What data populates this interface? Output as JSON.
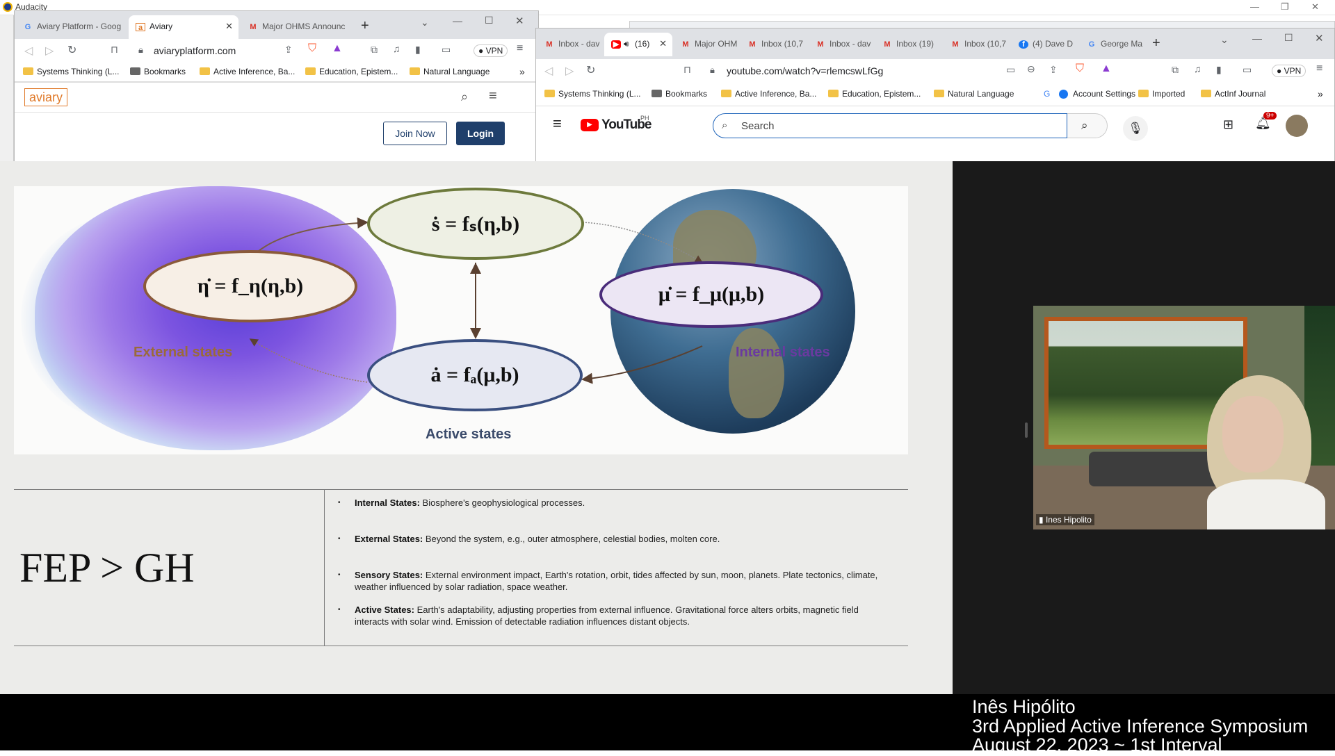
{
  "audacity": {
    "title": "Audacity"
  },
  "left_window": {
    "tabs": [
      {
        "label": "Aviary Platform - Goog"
      },
      {
        "label": "Aviary"
      },
      {
        "label": "Major OHMS Announc"
      }
    ],
    "url": "aviaryplatform.com",
    "vpn_label": "VPN",
    "bookmarks": [
      {
        "label": "Systems Thinking (L..."
      },
      {
        "label": "Bookmarks"
      },
      {
        "label": "Active Inference, Ba..."
      },
      {
        "label": "Education, Epistem..."
      },
      {
        "label": "Natural Language"
      }
    ],
    "page": {
      "logo": "aviary",
      "join_label": "Join Now",
      "login_label": "Login"
    }
  },
  "right_window": {
    "tabs": [
      {
        "label": "Inbox - dav"
      },
      {
        "label": "(16)"
      },
      {
        "label": "Major OHM"
      },
      {
        "label": "Inbox (10,7"
      },
      {
        "label": "Inbox - dav"
      },
      {
        "label": "Inbox (19)"
      },
      {
        "label": "Inbox (10,7"
      },
      {
        "label": "(4) Dave D"
      },
      {
        "label": "George Ma"
      }
    ],
    "url": "youtube.com/watch?v=rlemcswLfGg",
    "vpn_label": "VPN",
    "bookmarks": [
      {
        "label": "Systems Thinking (L..."
      },
      {
        "label": "Bookmarks"
      },
      {
        "label": "Active Inference, Ba..."
      },
      {
        "label": "Education, Epistem..."
      },
      {
        "label": "Natural Language"
      },
      {
        "label": "Account Settings"
      },
      {
        "label": "Imported"
      },
      {
        "label": "ActInf Journal"
      }
    ],
    "youtube": {
      "logo": "YouTube",
      "region": "PH",
      "search_placeholder": "Search",
      "notif_count": "9+"
    }
  },
  "slide": {
    "equations": {
      "s": "ṡ = fₛ(η,b)",
      "eta": "η̇ = f_η(η,b)",
      "mu": "μ̇ = f_μ(μ,b)",
      "a": "ȧ = fₐ(μ,b)"
    },
    "labels": {
      "external": "External states",
      "internal": "Internal states",
      "active": "Active states"
    },
    "title": "FEP > GH",
    "bullets": [
      {
        "term": "Internal States:",
        "text": " Biosphere's geophysiological processes."
      },
      {
        "term": "External States:",
        "text": " Beyond the system, e.g., outer atmosphere, celestial bodies, molten core."
      },
      {
        "term": "Sensory States:",
        "text": " External environment impact, Earth's rotation, orbit, tides affected by sun, moon, planets. Plate tectonics, climate, weather influenced by solar radiation, space weather."
      },
      {
        "term": "Active States:",
        "text": " Earth's adaptability, adjusting properties from external influence. Gravitational force alters orbits, magnetic field interacts with solar wind. Emission of detectable radiation influences distant objects."
      }
    ]
  },
  "video": {
    "participant": "Ines Hipolito"
  },
  "caption": {
    "line1": "Inês Hipólito",
    "line2": "3rd Applied Active Inference Symposium",
    "line3": "August 22, 2023 ~ 1st Interval"
  },
  "colors": {
    "aviary_navy": "#1f3f6b",
    "aviary_orange": "#e07a2a",
    "youtube_red": "#ff0000"
  }
}
